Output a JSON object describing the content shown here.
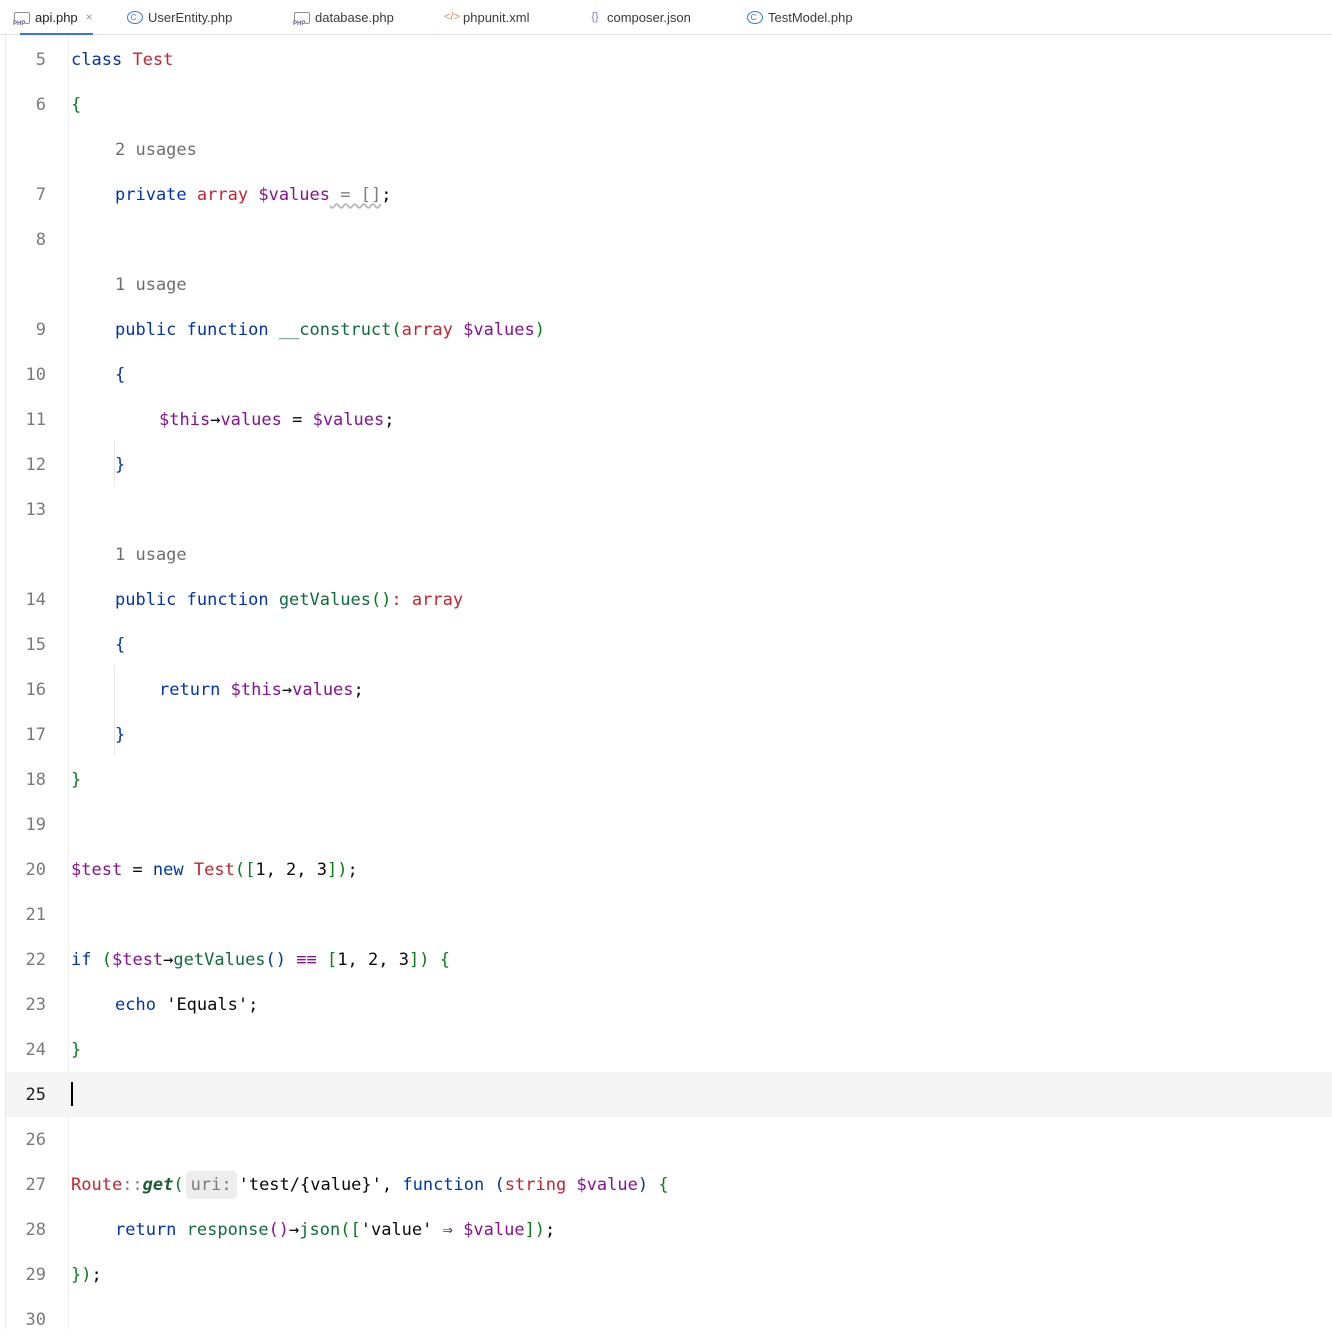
{
  "tabs": [
    {
      "label": "api.php",
      "icon": "php-file-icon",
      "active": true
    },
    {
      "label": "UserEntity.php",
      "icon": "class-icon"
    },
    {
      "label": "database.php",
      "icon": "php-file-icon"
    },
    {
      "label": "phpunit.xml",
      "icon": "xml-file-icon"
    },
    {
      "label": "composer.json",
      "icon": "json-file-icon"
    },
    {
      "label": "TestModel.php",
      "icon": "class-icon"
    }
  ],
  "tab_close_glyph": "×",
  "editor": {
    "current_line": "25",
    "line_numbers": [
      "5",
      "6",
      "7",
      "8",
      "9",
      "10",
      "11",
      "12",
      "13",
      "14",
      "15",
      "16",
      "17",
      "18",
      "19",
      "20",
      "21",
      "22",
      "23",
      "24",
      "25",
      "26",
      "27",
      "28",
      "29",
      "30"
    ],
    "usage_hints": [
      "2 usages",
      "1 usage",
      "1 usage"
    ],
    "param_hint": "uri:",
    "code": {
      "l5": [
        "class",
        "Test"
      ],
      "l6": [
        "{"
      ],
      "l7": [
        "private",
        "array",
        "$values",
        " = []",
        ";"
      ],
      "l9": [
        "public",
        "function",
        "__construct",
        "(",
        "array",
        "$values",
        ")"
      ],
      "l10": [
        "{"
      ],
      "l11": [
        "$this",
        "→",
        "values",
        " = ",
        "$values",
        ";"
      ],
      "l12": [
        "}"
      ],
      "l14": [
        "public",
        "function",
        "getValues",
        "()",
        ":",
        "array"
      ],
      "l15": [
        "{"
      ],
      "l16": [
        "return",
        "$this",
        "→",
        "values",
        ";"
      ],
      "l17": [
        "}"
      ],
      "l18": [
        "}"
      ],
      "l20": [
        "$test",
        " = ",
        "new",
        "Test",
        "([",
        "1",
        ", ",
        "2",
        ", ",
        "3",
        "])",
        ";"
      ],
      "l22": [
        "if",
        "(",
        "$test",
        "→",
        "getValues",
        "()",
        "≡≡",
        "[",
        "1",
        ", ",
        "2",
        ", ",
        "3",
        "]",
        ")",
        "{"
      ],
      "l23": [
        "echo",
        "'Equals'",
        ";"
      ],
      "l24": [
        "}"
      ],
      "l27": [
        "Route",
        "::",
        "get",
        "(",
        "'test/{value}'",
        ", ",
        "function",
        "(",
        "string",
        "$value",
        ")",
        "{"
      ],
      "l28": [
        "return",
        "response",
        "()",
        "→",
        "json",
        "([",
        "'value'",
        "⇒",
        "$value",
        "])",
        ";"
      ],
      "l29": [
        "})",
        ";"
      ]
    }
  },
  "colors": {
    "accent": "#3574f0",
    "keyword": "#0033b3",
    "class": "#c7222d",
    "variable": "#871094",
    "current_line_bg": "#f5f5f5"
  }
}
